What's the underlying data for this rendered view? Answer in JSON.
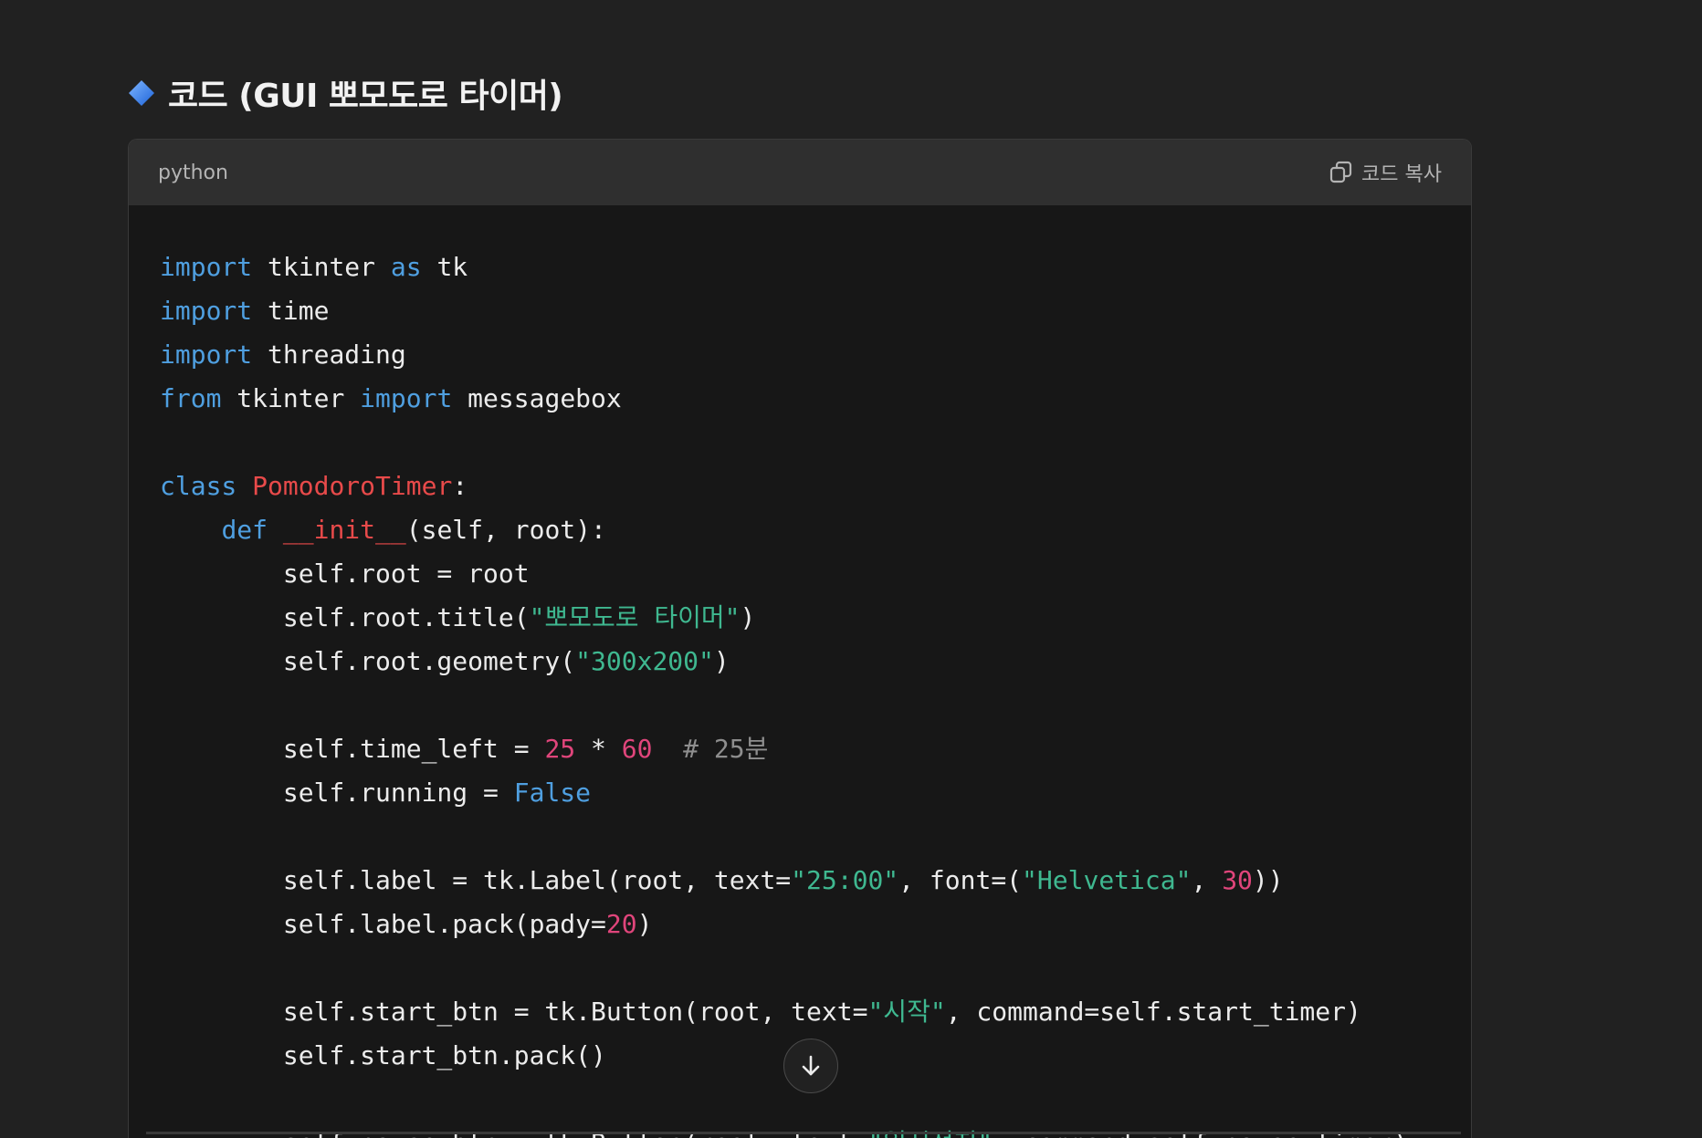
{
  "heading": {
    "text": "코드 (GUI 뽀모도로 타이머)",
    "icon": "blue-diamond-icon"
  },
  "code_block": {
    "language": "python",
    "copy_label": "코드 복사",
    "lines": [
      [
        {
          "t": "import",
          "c": "kw"
        },
        {
          "t": " tkinter "
        },
        {
          "t": "as",
          "c": "kw"
        },
        {
          "t": " tk"
        }
      ],
      [
        {
          "t": "import",
          "c": "kw"
        },
        {
          "t": " time"
        }
      ],
      [
        {
          "t": "import",
          "c": "kw"
        },
        {
          "t": " threading"
        }
      ],
      [
        {
          "t": "from",
          "c": "kw"
        },
        {
          "t": " tkinter "
        },
        {
          "t": "import",
          "c": "kw"
        },
        {
          "t": " messagebox"
        }
      ],
      [],
      [
        {
          "t": "class",
          "c": "kw"
        },
        {
          "t": " "
        },
        {
          "t": "PomodoroTimer",
          "c": "cls"
        },
        {
          "t": ":"
        }
      ],
      [
        {
          "t": "    "
        },
        {
          "t": "def",
          "c": "kw"
        },
        {
          "t": " "
        },
        {
          "t": "__init__",
          "c": "cls"
        },
        {
          "t": "(self, root):"
        }
      ],
      [
        {
          "t": "        self.root = root"
        }
      ],
      [
        {
          "t": "        self.root.title("
        },
        {
          "t": "\"뽀모도로 타이머\"",
          "c": "str"
        },
        {
          "t": ")"
        }
      ],
      [
        {
          "t": "        self.root.geometry("
        },
        {
          "t": "\"300x200\"",
          "c": "str"
        },
        {
          "t": ")"
        }
      ],
      [],
      [
        {
          "t": "        self.time_left = "
        },
        {
          "t": "25",
          "c": "num"
        },
        {
          "t": " * "
        },
        {
          "t": "60",
          "c": "num"
        },
        {
          "t": "  "
        },
        {
          "t": "# 25분",
          "c": "cmt"
        }
      ],
      [
        {
          "t": "        self.running = "
        },
        {
          "t": "False",
          "c": "kw"
        }
      ],
      [],
      [
        {
          "t": "        self.label = tk.Label(root, text="
        },
        {
          "t": "\"25:00\"",
          "c": "str"
        },
        {
          "t": ", font=("
        },
        {
          "t": "\"Helvetica\"",
          "c": "str"
        },
        {
          "t": ", "
        },
        {
          "t": "30",
          "c": "num"
        },
        {
          "t": "))"
        }
      ],
      [
        {
          "t": "        self.label.pack(pady="
        },
        {
          "t": "20",
          "c": "num"
        },
        {
          "t": ")"
        }
      ],
      [],
      [
        {
          "t": "        self.start_btn = tk.Button(root, text="
        },
        {
          "t": "\"시작\"",
          "c": "str"
        },
        {
          "t": ", command=self.start_timer)"
        }
      ],
      [
        {
          "t": "        self.start_btn.pack()"
        }
      ],
      [],
      [
        {
          "t": "        self.pause_btn = tk.Button(root, text="
        },
        {
          "t": "\"일시정지\"",
          "c": "str"
        },
        {
          "t": ", command=self.pause_timer)"
        }
      ]
    ]
  },
  "scroll_button": {
    "icon": "arrow-down-icon"
  },
  "colors": {
    "background": "#212121",
    "code_background": "#171717",
    "header_background": "#2f2f2f",
    "keyword": "#4f9fe0",
    "class_name": "#e84a4a",
    "string": "#3fb890",
    "number": "#e0457b",
    "comment": "#8e8e8e",
    "diamond": "#3b82f6"
  }
}
